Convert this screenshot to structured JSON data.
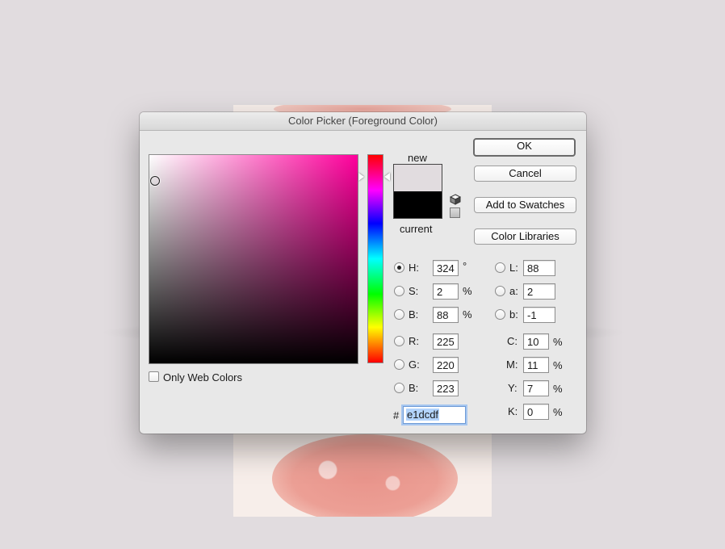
{
  "dialog": {
    "title": "Color Picker (Foreground Color)"
  },
  "buttons": {
    "ok": "OK",
    "cancel": "Cancel",
    "add_to_swatches": "Add to Swatches",
    "color_libraries": "Color Libraries"
  },
  "swatch": {
    "new_label": "new",
    "current_label": "current",
    "new_color": "#e1dcdf",
    "current_color": "#000000"
  },
  "picker": {
    "field_hue_color": "#ff009c",
    "only_web_colors_label": "Only Web Colors",
    "only_web_colors_checked": false
  },
  "hsb": {
    "h": {
      "label": "H:",
      "value": "324",
      "unit": "°",
      "selected": true
    },
    "s": {
      "label": "S:",
      "value": "2",
      "unit": "%"
    },
    "b": {
      "label": "B:",
      "value": "88",
      "unit": "%"
    }
  },
  "rgb": {
    "r": {
      "label": "R:",
      "value": "225"
    },
    "g": {
      "label": "G:",
      "value": "220"
    },
    "b": {
      "label": "B:",
      "value": "223"
    }
  },
  "lab": {
    "l": {
      "label": "L:",
      "value": "88"
    },
    "a": {
      "label": "a:",
      "value": "2"
    },
    "b": {
      "label": "b:",
      "value": "-1"
    }
  },
  "cmyk": {
    "c": {
      "label": "C:",
      "value": "10",
      "unit": "%"
    },
    "m": {
      "label": "M:",
      "value": "11",
      "unit": "%"
    },
    "y": {
      "label": "Y:",
      "value": "7",
      "unit": "%"
    },
    "k": {
      "label": "K:",
      "value": "0",
      "unit": "%"
    }
  },
  "hex": {
    "prefix": "#",
    "value": "e1dcdf"
  }
}
